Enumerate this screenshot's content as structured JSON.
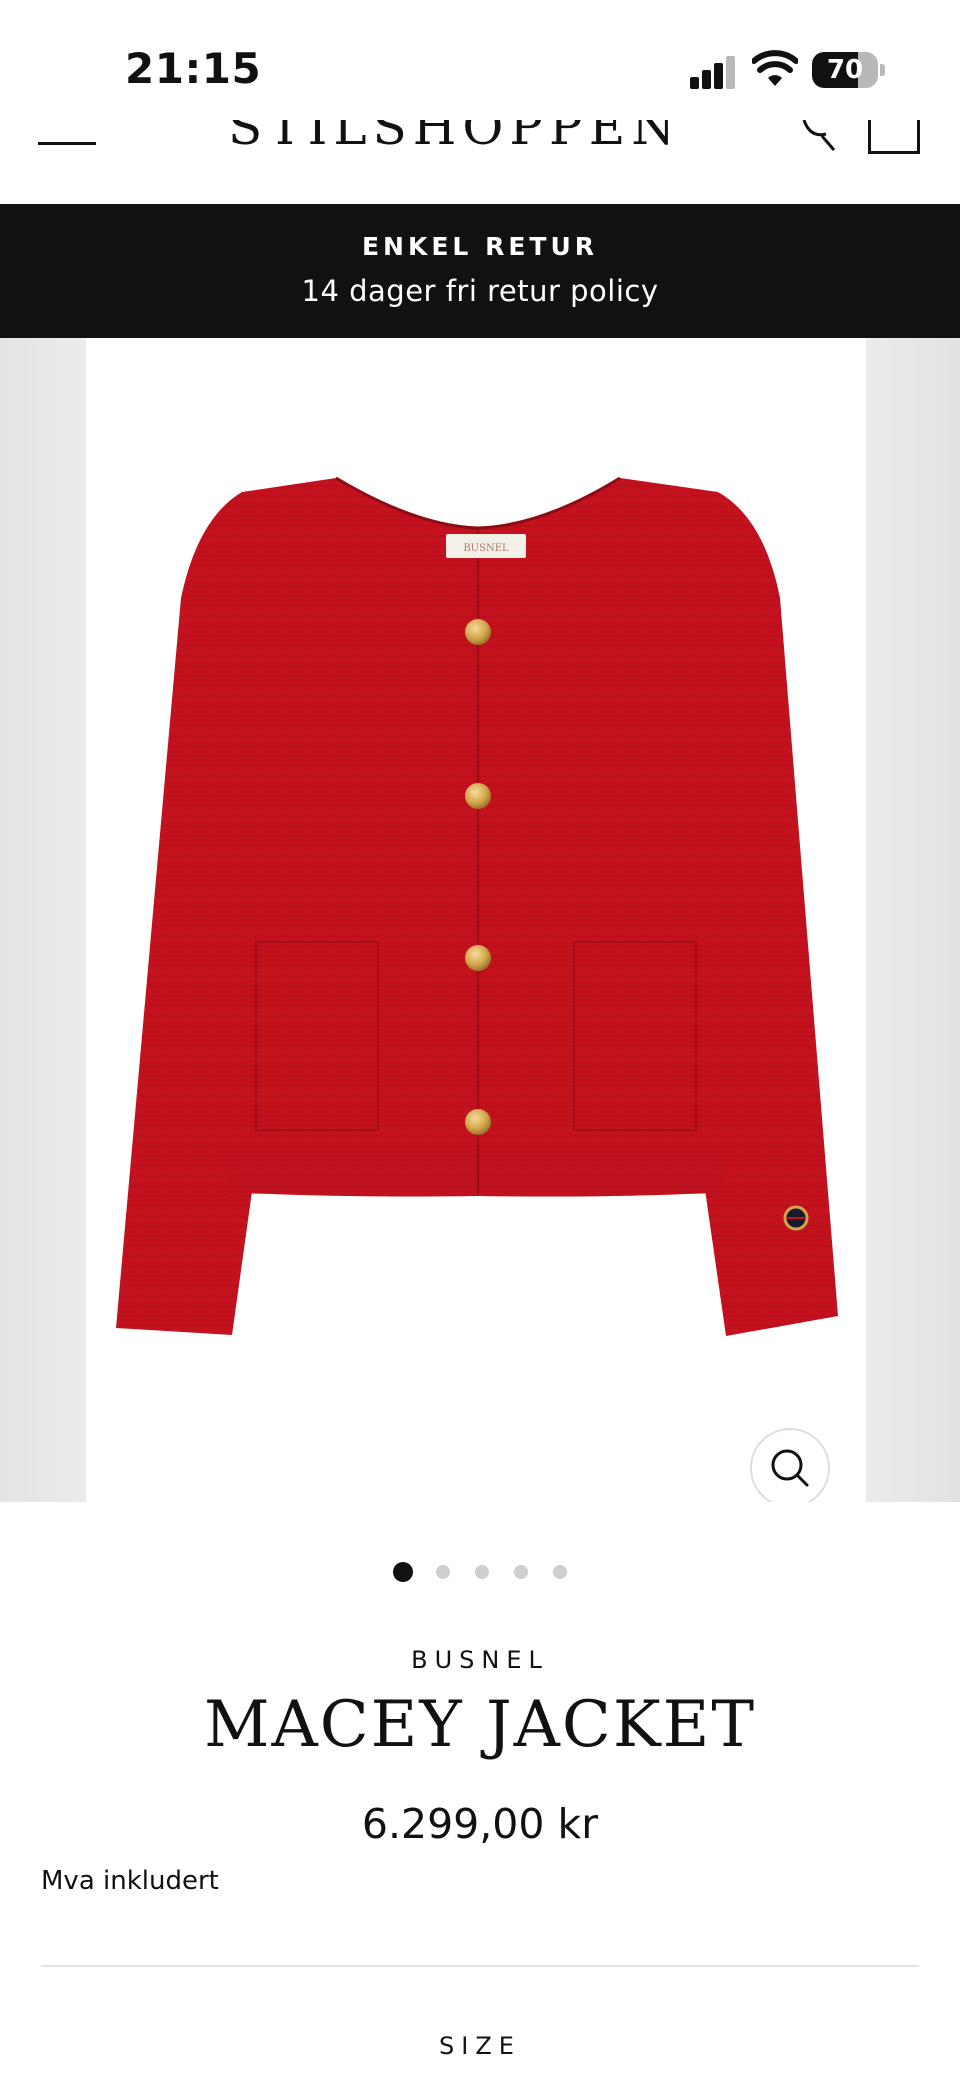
{
  "status_bar": {
    "time": "21:15",
    "battery": "70",
    "battery_level": 0.7
  },
  "header": {
    "logo": "STILSHOPPEN"
  },
  "announcement": {
    "title": "ENKEL RETUR",
    "subtitle": "14 dager fri retur policy"
  },
  "gallery": {
    "slide_count": 5,
    "active_slide": 1,
    "tag_text": "BUSNEL"
  },
  "product": {
    "brand": "BUSNEL",
    "name": "MACEY JACKET",
    "price": "6.299,00 kr",
    "vat_note": "Mva inkludert"
  },
  "options": {
    "size_label": "SIZE"
  },
  "colors": {
    "jacket": "#c3121e",
    "announce_bg": "#111111",
    "buttons": "#d4a84b"
  }
}
